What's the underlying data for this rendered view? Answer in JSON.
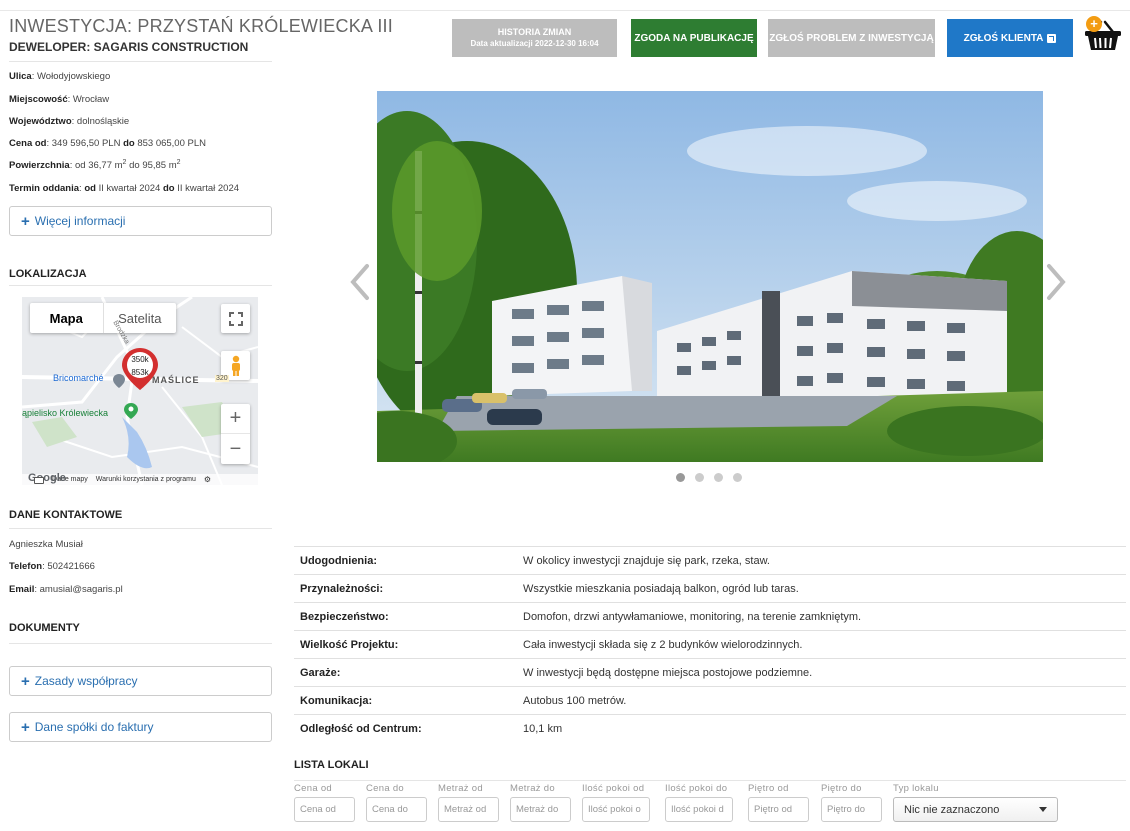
{
  "header": {
    "title": "INWESTYCJA: PRZYSTAŃ KRÓLEWIECKA III",
    "developer": "DEWELOPER: SAGARIS CONSTRUCTION",
    "history_label": "HISTORIA ZMIAN",
    "history_sub": "Data aktualizacji 2022-12-30 16:04",
    "consent_label": "ZGODA NA PUBLIKACJĘ",
    "problem_label": "ZGŁOŚ PROBLEM Z INWESTYCJĄ",
    "client_label": "ZGŁOŚ KLIENTA",
    "basket_badge": "+"
  },
  "info": {
    "street_label": "Ulica",
    "street": "Wołodyjowskiego",
    "city_label": "Miejscowość",
    "city": "Wrocław",
    "region_label": "Województwo",
    "region": "dolnośląskie",
    "price_label": "Cena od",
    "price_from": "349 596,50 PLN",
    "price_to_label": "do",
    "price_to": "853 065,00 PLN",
    "area_label": "Powierzchnia",
    "area_from_label": "od",
    "area_from": "36,77 m",
    "area_to_label": "do",
    "area_to": "95,85 m",
    "area_unit_sup": "2",
    "term_label": "Termin oddania",
    "term_from_label": "od",
    "term_from": "II kwartał 2024",
    "term_to_label": "do",
    "term_to": "II kwartał 2024",
    "more_info": "Więcej informacji"
  },
  "location": {
    "title": "LOKALIZACJA",
    "map_tab_map": "Mapa",
    "map_tab_satellite": "Satelita",
    "pin_price_from": "350k",
    "pin_price_to": "853k",
    "place_1": "Bricomarché",
    "place_2": "MAŚLICE",
    "place_3": "ąpielisko Królewiecka",
    "place_road": "320",
    "place_street": "Brodzka",
    "map_footer_logo": "Google",
    "map_footer_data": "Dane mapy",
    "map_footer_terms": "Warunki korzystania z programu"
  },
  "contact": {
    "title": "DANE KONTAKTOWE",
    "name": "Agnieszka Musiał",
    "phone_label": "Telefon",
    "phone": "502421666",
    "email_label": "Email",
    "email": "amusial@sagaris.pl"
  },
  "documents": {
    "title": "DOKUMENTY",
    "doc_1": "Zasady współpracy",
    "doc_2": "Dane spółki do faktury"
  },
  "gallery": {
    "slide_count": 4,
    "active_slide": 1
  },
  "details": [
    {
      "label": "Udogodnienia:",
      "value": "W okolicy inwestycji znajduje się park, rzeka, staw."
    },
    {
      "label": "Przynależności:",
      "value": "Wszystkie mieszkania posiadają balkon, ogród lub taras."
    },
    {
      "label": "Bezpieczeństwo:",
      "value": "Domofon, drzwi antywłamaniowe, monitoring, na terenie zamkniętym."
    },
    {
      "label": "Wielkość Projektu:",
      "value": "Cała inwestycji składa się z 2 budynków wielorodzinnych."
    },
    {
      "label": "Garaże:",
      "value": "W inwestycji będą dostępne miejsca postojowe podziemne."
    },
    {
      "label": "Komunikacja:",
      "value": "Autobus 100 metrów."
    },
    {
      "label": "Odległość od Centrum:",
      "value": "10,1 km"
    }
  ],
  "listing": {
    "title": "LISTA LOKALI",
    "filters": [
      {
        "label": "Cena od",
        "placeholder": "Cena od"
      },
      {
        "label": "Cena do",
        "placeholder": "Cena do"
      },
      {
        "label": "Metraż od",
        "placeholder": "Metraż od"
      },
      {
        "label": "Metraż do",
        "placeholder": "Metraż do"
      },
      {
        "label": "Ilość pokoi od",
        "placeholder": "Ilość pokoi o"
      },
      {
        "label": "Ilość pokoi do",
        "placeholder": "Ilość pokoi d"
      },
      {
        "label": "Piętro od",
        "placeholder": "Piętro od"
      },
      {
        "label": "Piętro do",
        "placeholder": "Piętro do"
      }
    ],
    "type_label": "Typ lokalu",
    "type_value": "Nic nie zaznaczono"
  },
  "colors": {
    "consent": "#2e7d32",
    "client": "#1f78c8",
    "disabled": "#bdbdbd",
    "link": "#2a6fb0",
    "pin": "#d32f2f",
    "basket_badge": "#f39c12"
  }
}
